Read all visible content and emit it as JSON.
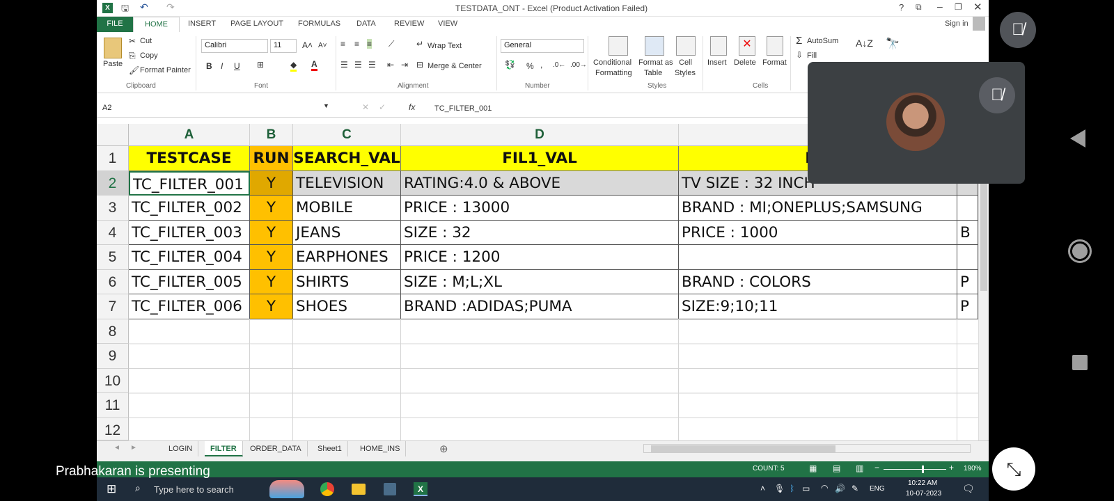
{
  "window": {
    "title": "TESTDATA_ONT - Excel (Product Activation Failed)",
    "sign_in": "Sign in"
  },
  "ribbon_tabs": [
    "FILE",
    "HOME",
    "INSERT",
    "PAGE LAYOUT",
    "FORMULAS",
    "DATA",
    "REVIEW",
    "VIEW"
  ],
  "clipboard": {
    "paste": "Paste",
    "cut": "Cut",
    "copy": "Copy",
    "format_painter": "Format Painter",
    "group": "Clipboard"
  },
  "font": {
    "name": "Calibri",
    "size": "11",
    "group": "Font",
    "bold": "B",
    "italic": "I",
    "underline": "U"
  },
  "alignment": {
    "wrap": "Wrap Text",
    "merge": "Merge & Center",
    "group": "Alignment"
  },
  "number": {
    "format": "General",
    "percent": "%",
    "comma": ",",
    "group": "Number"
  },
  "styles": {
    "conditional": "Conditional",
    "formatting": "Formatting",
    "format_as": "Format as",
    "table": "Table",
    "cell": "Cell",
    "styles_lbl": "Styles",
    "group": "Styles"
  },
  "cells": {
    "insert": "Insert",
    "delete": "Delete",
    "format": "Format",
    "group": "Cells"
  },
  "editing": {
    "autosum": "AutoSum",
    "fill": "Fill"
  },
  "formula_bar": {
    "name_box": "A2",
    "fx": "fx",
    "value": "TC_FILTER_001"
  },
  "columns": [
    "A",
    "B",
    "C",
    "D"
  ],
  "rows": [
    "1",
    "2",
    "3",
    "4",
    "5",
    "6",
    "7",
    "8",
    "9",
    "10",
    "11",
    "12"
  ],
  "header": {
    "a": "TESTCASE",
    "b": "RUN",
    "c": "SEARCH_VAL",
    "d": "FIL1_VAL",
    "e": "FIL"
  },
  "data": [
    {
      "a": "TC_FILTER_001",
      "b": "Y",
      "c": "TELEVISION",
      "d": "RATING:4.0 & ABOVE",
      "e": "TV SIZE : 32 INCH",
      "f": ""
    },
    {
      "a": "TC_FILTER_002",
      "b": "Y",
      "c": "MOBILE",
      "d": "PRICE : 13000",
      "e": "BRAND : MI;ONEPLUS;SAMSUNG",
      "f": ""
    },
    {
      "a": "TC_FILTER_003",
      "b": "Y",
      "c": "JEANS",
      "d": "SIZE : 32",
      "e": "PRICE : 1000",
      "f": "B"
    },
    {
      "a": "TC_FILTER_004",
      "b": "Y",
      "c": "EARPHONES",
      "d": "PRICE : 1200",
      "e": "",
      "f": ""
    },
    {
      "a": "TC_FILTER_005",
      "b": "Y",
      "c": "SHIRTS",
      "d": "SIZE : M;L;XL",
      "e": "BRAND : COLORS",
      "f": "P"
    },
    {
      "a": "TC_FILTER_006",
      "b": "Y",
      "c": "SHOES",
      "d": "BRAND :ADIDAS;PUMA",
      "e": "SIZE:9;10;11",
      "f": "P"
    }
  ],
  "sheets": [
    "LOGIN",
    "FILTER",
    "ORDER_DATA",
    "Sheet1",
    "HOME_INS"
  ],
  "status": {
    "count": "COUNT: 5",
    "zoom": "190%"
  },
  "presenter": "Prabhakaran is presenting",
  "taskbar": {
    "search": "Type here to search",
    "lang": "ENG",
    "time": "10:22 AM",
    "date": "10-07-2023"
  }
}
